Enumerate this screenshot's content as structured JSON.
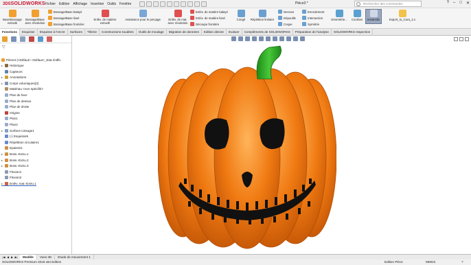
{
  "app": {
    "logo_prefix": "3DS",
    "logo_text": "SOLIDWORKS",
    "menu": [
      "Fichier",
      "Edition",
      "Affichage",
      "Insertion",
      "Outils",
      "Fenêtre"
    ],
    "document_title": "Pièce3 *",
    "search_placeholder": "Rechercher des commandes"
  },
  "ribbon": {
    "large_buttons": [
      {
        "label_1": "Base/Bossage",
        "label_2": "extrudé",
        "color": "#f0a030"
      },
      {
        "label_1": "Bossage/Base",
        "label_2": "avec révolution",
        "color": "#f0a030"
      },
      {
        "label_1": "Enlèv. de matière",
        "label_2": "extrudé",
        "color": "#e05050"
      },
      {
        "label_1": "Assistance pour le perçage",
        "label_2": "",
        "color": "#7aa6d6"
      },
      {
        "label_1": "Enlèv. de mat.",
        "label_2": "avec révolution",
        "color": "#e05050"
      },
      {
        "label_1": "Congé",
        "label_2": "",
        "color": "#6aa0d0"
      },
      {
        "label_1": "Répétition linéaire",
        "label_2": "",
        "color": "#6aa0d0"
      },
      {
        "label_1": "Géométrie...",
        "label_2": "",
        "color": "#5aa0d0"
      },
      {
        "label_1": "Courbes",
        "label_2": "",
        "color": "#5aa0d0"
      },
      {
        "label_1": "Instant3D",
        "label_2": "",
        "color": "#9aa8c0"
      },
      {
        "label_1": "Export_to_Cura_2.x",
        "label_2": "",
        "color": "#f2c24a"
      }
    ],
    "small_buttons": [
      "Bossage/Base balayé",
      "Bossage/Base lissé",
      "Bossage/Base frontière",
      "Enlèv. de matière balayé",
      "Enlèv. de matière lissé",
      "Découpe frontière",
      "Nervure",
      "Dépouille",
      "Coque",
      "Enroulement",
      "Intersection",
      "Symétrie"
    ]
  },
  "tabs": [
    "Fonctions",
    "Esquisse",
    "Esquisse à l'encre",
    "Surfaces",
    "Tôlerie",
    "Constructions soudées",
    "Outils de moulage",
    "Migration de données",
    "Edition directe",
    "Evaluer",
    "Compléments de SOLIDWORKS",
    "Préparation de l'analyse",
    "SOLIDWORKS Inspection"
  ],
  "active_tab": "Fonctions",
  "tree": {
    "root": "Pièce3 (<Défaut> <Défaut>_Etat d'affic",
    "items": [
      {
        "label": "Historique",
        "icon": "history-icon",
        "expand": true,
        "color": "#8a6a40"
      },
      {
        "label": "Capteurs",
        "icon": "sensor-icon",
        "expand": false,
        "color": "#6080b0"
      },
      {
        "label": "Annotations",
        "icon": "annotation-icon",
        "expand": true,
        "color": "#d0a030"
      },
      {
        "label": "Corps volumiques(3)",
        "icon": "solid-bodies-icon",
        "expand": true,
        "color": "#8090b0"
      },
      {
        "label": "Matériau <non spécifié>",
        "icon": "material-icon",
        "expand": false,
        "color": "#b09060"
      },
      {
        "label": "Plan de face",
        "icon": "plane-icon",
        "expand": false,
        "color": "#9aaccc"
      },
      {
        "label": "Plan de dessus",
        "icon": "plane-icon",
        "expand": false,
        "color": "#9aaccc"
      },
      {
        "label": "Plan de droite",
        "icon": "plane-icon",
        "expand": false,
        "color": "#9aaccc"
      },
      {
        "label": "Origine",
        "icon": "origin-icon",
        "expand": false,
        "color": "#c04040"
      },
      {
        "label": "Plan1",
        "icon": "plane-icon",
        "expand": false,
        "color": "#9aaccc"
      },
      {
        "label": "Plan2",
        "icon": "plane-icon",
        "expand": false,
        "color": "#9aaccc"
      },
      {
        "label": "Surface-Lissage1",
        "icon": "surface-loft-icon",
        "expand": true,
        "color": "#80a0c0"
      },
      {
        "label": "(-) Esquisse5",
        "icon": "sketch-icon",
        "expand": false,
        "color": "#6a8ad0"
      },
      {
        "label": "Répétition circulaire1",
        "icon": "circular-pattern-icon",
        "expand": false,
        "color": "#6a8ad0"
      },
      {
        "label": "Epaissir1",
        "icon": "thicken-icon",
        "expand": false,
        "color": "#d09040"
      },
      {
        "label": "Boss.-Extru.1",
        "icon": "extrude-icon",
        "expand": true,
        "color": "#d09040"
      },
      {
        "label": "Boss.-Extru.2",
        "icon": "extrude-icon",
        "expand": true,
        "color": "#d09040"
      },
      {
        "label": "Boss.-Extru.3",
        "icon": "extrude-icon",
        "expand": true,
        "color": "#d09040"
      },
      {
        "label": "Flexion1",
        "icon": "flex-icon",
        "expand": false,
        "color": "#8a9ab0"
      },
      {
        "label": "Flexion2",
        "icon": "flex-icon",
        "expand": false,
        "color": "#8a9ab0"
      },
      {
        "label": "Enlèv. mat.-Extru.1",
        "icon": "cut-extrude-icon",
        "expand": true,
        "color": "#d06040"
      }
    ]
  },
  "bottom_tabs": [
    "Modèle",
    "Vues 3D",
    "Etude de mouvement 1"
  ],
  "active_bottom_tab": "Modèle",
  "status": {
    "left": "SOLIDWORKS Premium 2018 x64 Edition",
    "mode": "Edition Pièce",
    "units": "MMGS"
  },
  "colors": {
    "pumpkin": "#f07a12",
    "stem": "#2fae22",
    "face": "#111111",
    "accent_red": "#c8102e"
  }
}
